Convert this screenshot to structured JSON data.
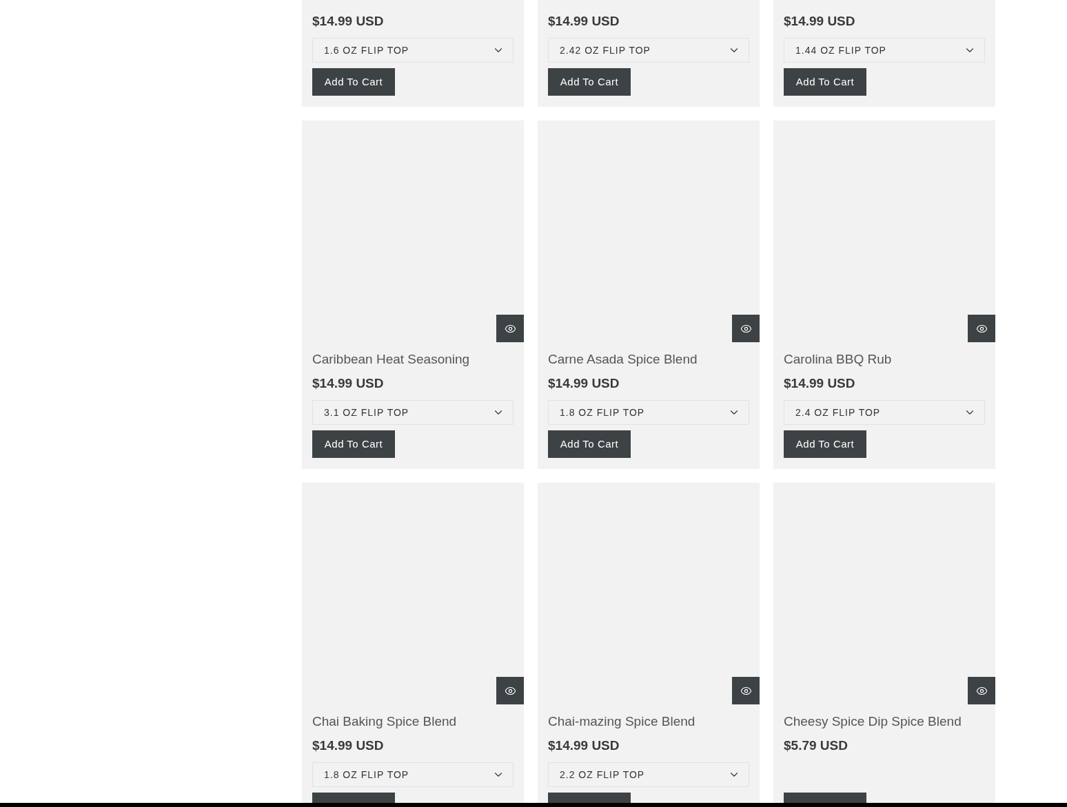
{
  "products": [
    {
      "price": "$14.99 USD",
      "variant": "1.6 OZ FLIP TOP",
      "button": "Add To Cart"
    },
    {
      "price": "$14.99 USD",
      "variant": "2.42 OZ FLIP TOP",
      "button": "Add To Cart"
    },
    {
      "price": "$14.99 USD",
      "variant": "1.44 OZ FLIP TOP",
      "button": "Add To Cart"
    },
    {
      "title": "Caribbean Heat Seasoning",
      "price": "$14.99 USD",
      "variant": "3.1 OZ FLIP TOP",
      "button": "Add To Cart"
    },
    {
      "title": "Carne Asada Spice Blend",
      "price": "$14.99 USD",
      "variant": "1.8 OZ FLIP TOP",
      "button": "Add To Cart"
    },
    {
      "title": "Carolina BBQ Rub",
      "price": "$14.99 USD",
      "variant": "2.4 OZ FLIP TOP",
      "button": "Add To Cart"
    },
    {
      "title": "Chai Baking Spice Blend",
      "price": "$14.99 USD",
      "variant": "1.8 OZ FLIP TOP"
    },
    {
      "title": "Chai-mazing Spice Blend",
      "price": "$14.99 USD",
      "variant": "2.2 OZ FLIP TOP"
    },
    {
      "title": "Cheesy Spice Dip Spice Blend",
      "price": "$5.79 USD"
    }
  ]
}
